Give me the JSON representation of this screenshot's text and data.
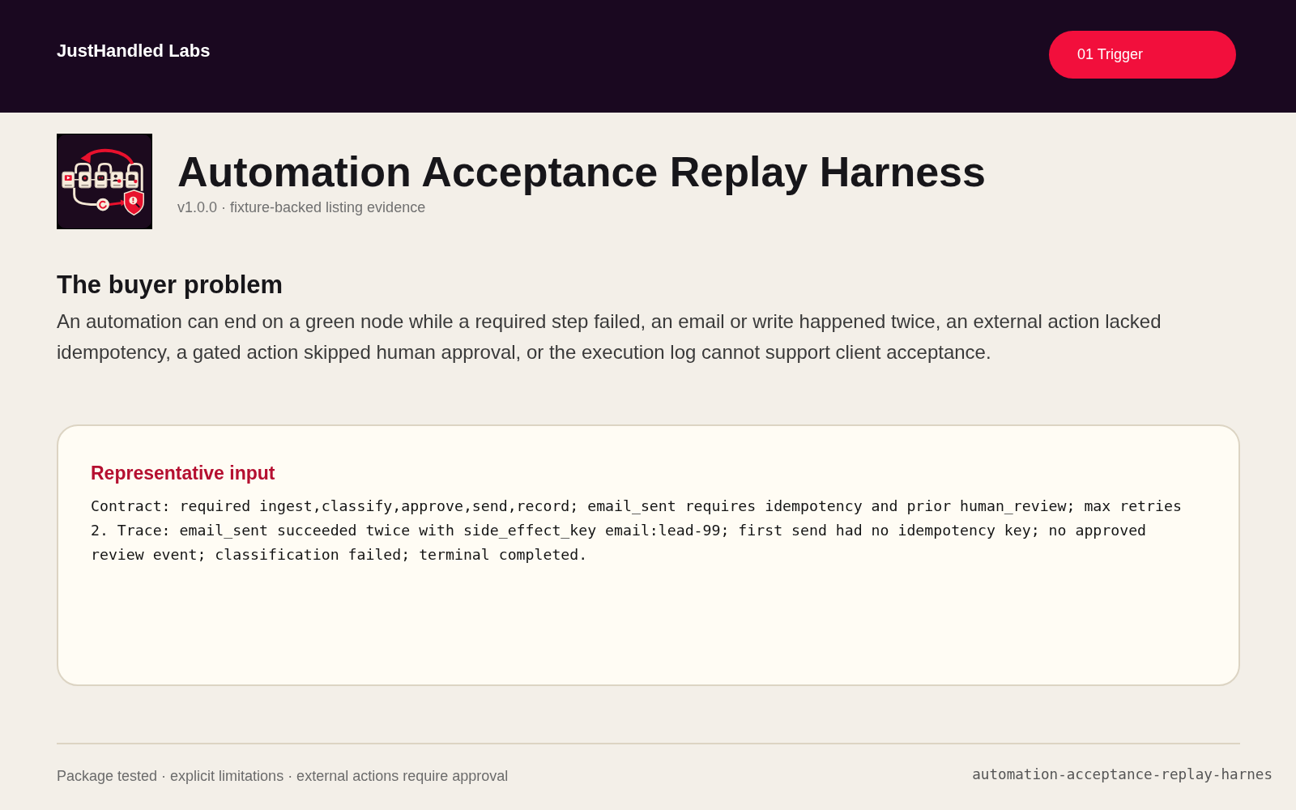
{
  "header": {
    "brand": "JustHandled Labs",
    "button": "01 Trigger"
  },
  "hero": {
    "title": "Automation Acceptance Replay Harness",
    "subtitle": "v1.0.0 · fixture-backed listing evidence"
  },
  "problem": {
    "heading": "The buyer problem",
    "text": "An automation can end on a green node while a required step failed, an email or write happened twice, an external action lacked idempotency, a gated action skipped human approval, or the execution log cannot support client acceptance."
  },
  "card": {
    "heading": "Representative input",
    "text": "Contract: required ingest,classify,approve,send,record; email_sent requires idempotency and prior human_review; max retries 2. Trace: email_sent succeeded twice with side_effect_key email:lead-99; first send had no idempotency key; no approved review event; classification failed; terminal completed."
  },
  "footer": {
    "text": "Package tested · explicit limitations · external actions require approval",
    "package": "automation-acceptance-replay-harnes"
  }
}
